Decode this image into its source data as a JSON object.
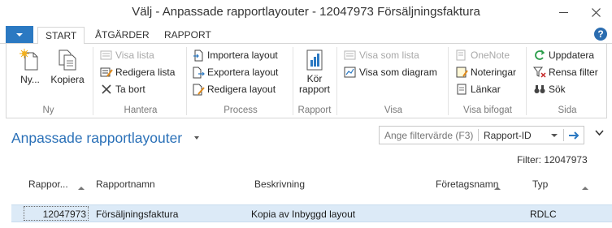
{
  "window": {
    "title": "Välj - Anpassade rapportlayouter - 12047973 Försäljningsfaktura"
  },
  "ribbon": {
    "tabs": [
      {
        "label": "START"
      },
      {
        "label": "ÅTGÄRDER"
      },
      {
        "label": "RAPPORT"
      }
    ],
    "groups": {
      "ny": {
        "label": "Ny",
        "new_label": "Ny...",
        "copy_label": "Kopiera"
      },
      "hantera": {
        "label": "Hantera",
        "view_list": "Visa lista",
        "edit_list": "Redigera lista",
        "delete": "Ta bort"
      },
      "process": {
        "label": "Process",
        "import": "Importera layout",
        "export": "Exportera layout",
        "edit": "Redigera layout"
      },
      "rapport": {
        "label": "Rapport",
        "run_line1": "Kör",
        "run_line2": "rapport"
      },
      "visa": {
        "label": "Visa",
        "view_as_list": "Visa som lista",
        "view_as_chart": "Visa som diagram"
      },
      "visa_bifogat": {
        "label": "Visa bifogat",
        "onenote": "OneNote",
        "notes": "Noteringar",
        "links": "Länkar"
      },
      "sida": {
        "label": "Sida",
        "refresh": "Uppdatera",
        "clear_filter": "Rensa filter",
        "search": "Sök"
      }
    }
  },
  "page": {
    "title": "Anpassade rapportlayouter",
    "filter_placeholder": "Ange filtervärde (F3)",
    "filter_field": "Rapport-ID",
    "filter_summary": "Filter: 12047973"
  },
  "table": {
    "columns": [
      "Rappor...",
      "Rapportnamn",
      "Beskrivning",
      "Företagsnamn",
      "Typ"
    ],
    "rows": [
      {
        "id": "12047973",
        "name": "Försäljningsfaktura",
        "description": "Kopia av Inbyggd layout",
        "company": "",
        "type": "RDLC"
      }
    ]
  },
  "colors": {
    "accent": "#2b79c2",
    "title_blue": "#2b71b8",
    "selected_row": "#dceaf7"
  }
}
